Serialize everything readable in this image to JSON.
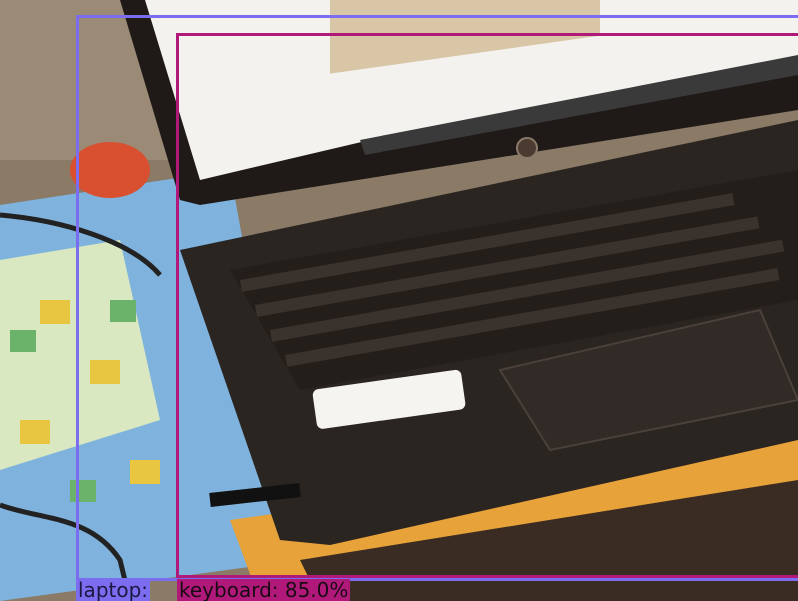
{
  "image": {
    "description_icons": [
      "laptop-icon",
      "keyboard-icon",
      "touchpad-icon",
      "hp-logo-icon",
      "cable-icon",
      "board-game-mat-icon"
    ]
  },
  "detections": [
    {
      "id": "laptop",
      "label": "laptop:",
      "color": "#7b6cf0"
    },
    {
      "id": "keyboard",
      "label": "keyboard: 85.0%",
      "color": "#b0197a"
    }
  ],
  "colors": {
    "laptop_body": "#2b2522",
    "screen": "#f4f2ee",
    "mat_blue": "#7fb3dd",
    "mat_yellow": "#e8c640",
    "table_orange": "#e8a23a"
  }
}
